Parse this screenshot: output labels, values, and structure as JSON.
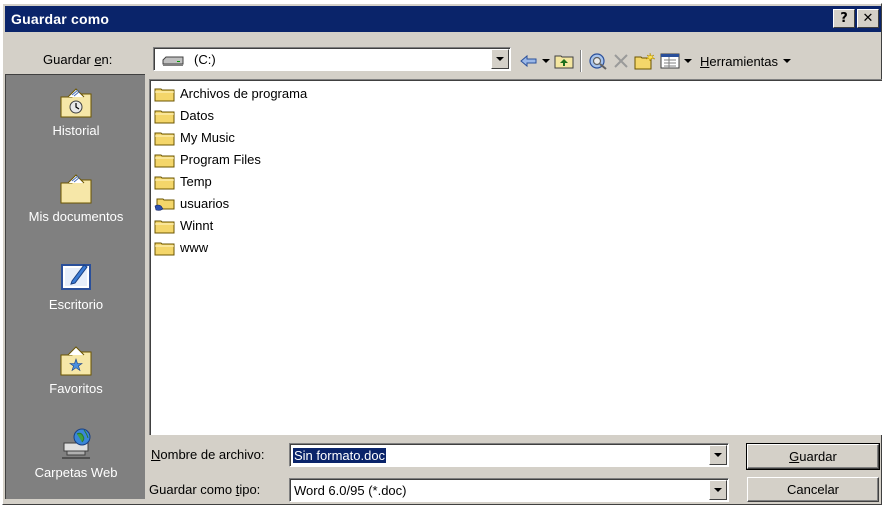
{
  "window": {
    "title": "Guardar como",
    "help_glyph": "?",
    "close_glyph": "✕"
  },
  "save_in": {
    "label_prefix": "Guardar ",
    "label_accel": "e",
    "label_suffix": "n:",
    "value": "(C:)",
    "drive_icon": "drive-icon"
  },
  "toolbar": {
    "back_icon": "back-arrow-icon",
    "up_icon": "up-folder-icon",
    "search_web_icon": "search-web-icon",
    "delete_icon": "delete-icon",
    "new_folder_icon": "new-folder-icon",
    "views_icon": "views-icon",
    "tools_accel": "H",
    "tools_rest": "erramientas"
  },
  "places": [
    {
      "label": "Historial",
      "icon": "history-icon"
    },
    {
      "label": "Mis documentos",
      "icon": "my-documents-icon"
    },
    {
      "label": "Escritorio",
      "icon": "desktop-icon"
    },
    {
      "label": "Favoritos",
      "icon": "favorites-icon"
    },
    {
      "label": "Carpetas Web",
      "icon": "web-folders-icon"
    }
  ],
  "files": [
    {
      "name": "Archivos de programa",
      "icon": "folder-icon"
    },
    {
      "name": "Datos",
      "icon": "folder-icon"
    },
    {
      "name": "My Music",
      "icon": "folder-icon"
    },
    {
      "name": "Program Files",
      "icon": "folder-icon"
    },
    {
      "name": "Temp",
      "icon": "folder-icon"
    },
    {
      "name": "usuarios",
      "icon": "shared-folder-icon"
    },
    {
      "name": "Winnt",
      "icon": "folder-icon"
    },
    {
      "name": "www",
      "icon": "folder-icon"
    }
  ],
  "filename": {
    "label_accel": "N",
    "label_rest": "ombre de archivo:",
    "value": "Sin formato.doc"
  },
  "filetype": {
    "label_prefix": "Guardar como ",
    "label_accel": "t",
    "label_suffix": "ipo:",
    "value": "Word 6.0/95 (*.doc)"
  },
  "buttons": {
    "save_accel": "G",
    "save_rest": "uardar",
    "cancel": "Cancelar"
  },
  "colors": {
    "titlebar": "#0a246a",
    "face": "#d4d0c8",
    "places_bg": "#808080",
    "folder": "#f4d66a"
  }
}
